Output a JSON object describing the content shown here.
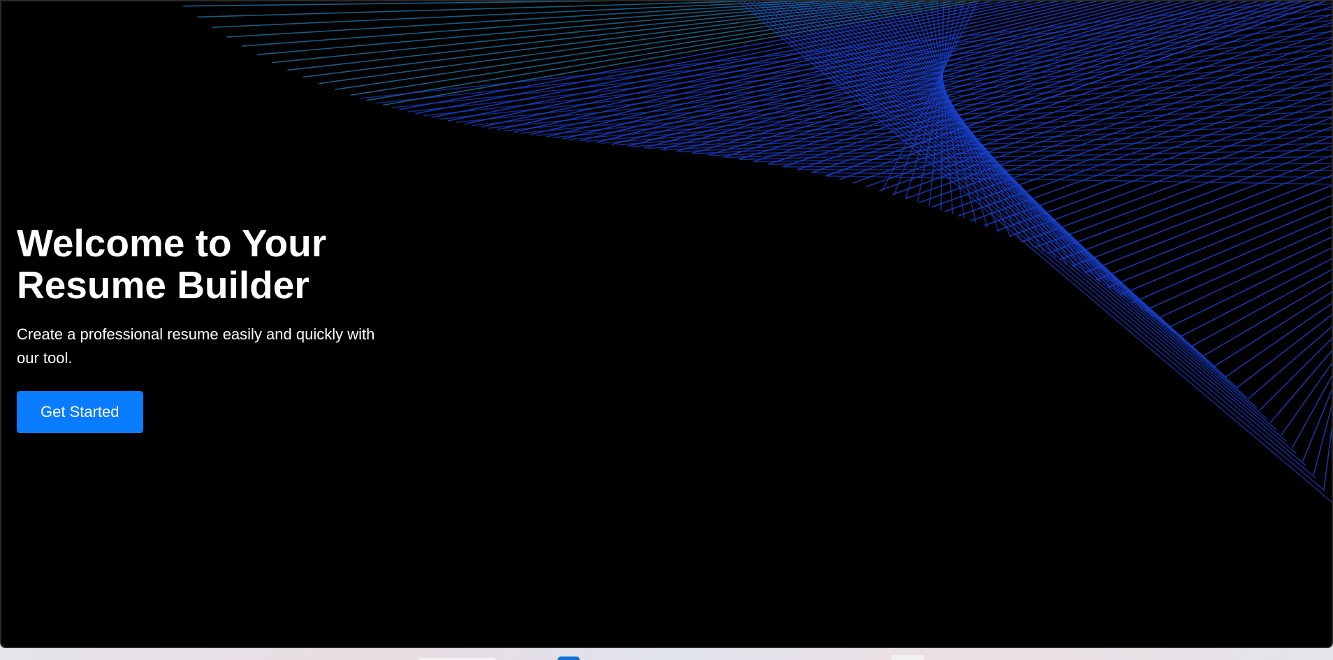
{
  "hero": {
    "title_line1": "Welcome to Your",
    "title_line2": "Resume Builder",
    "subtitle": "Create a professional resume easily and quickly with our tool.",
    "cta_label": "Get Started"
  },
  "colors": {
    "background": "#000000",
    "accent": "#0a7cff",
    "line_blue": "#1a3fc8",
    "line_teal": "#1b6f9a",
    "text": "#ffffff"
  },
  "decoration": {
    "icon": "wave-mesh-lines"
  },
  "taskbar": {
    "icons": [
      "taskbar-pill",
      "app-icon",
      "tray-square"
    ]
  }
}
